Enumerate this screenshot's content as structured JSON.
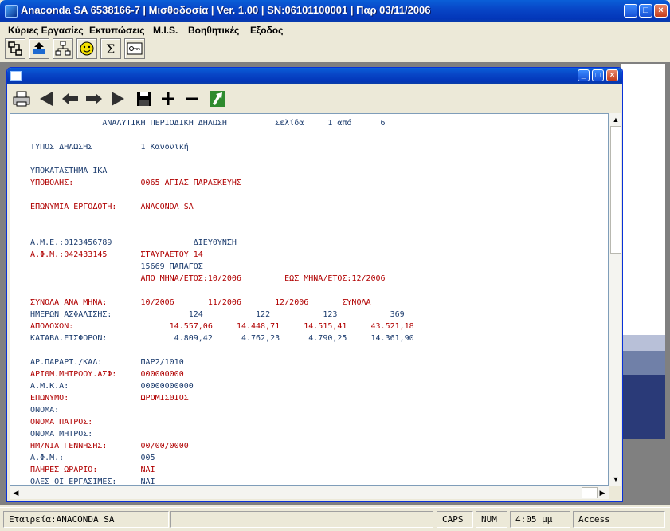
{
  "window": {
    "title": "Anaconda SA 6538166-7 | Μισθοδοσία | Ver. 1.00 | SN:06101100001 | Παρ 03/11/2006",
    "minimize": "_",
    "maximize": "□",
    "close": "×"
  },
  "menu": [
    "Κύριες Εργασίες",
    "Εκτυπώσεις",
    "M.I.S.",
    "Βοηθητικές",
    "Εξοδος"
  ],
  "main_toolbar_icons": [
    "org-chart-icon",
    "import-icon",
    "network-icon",
    "smiley-icon",
    "sigma-icon",
    "key-icon"
  ],
  "child_toolbar_icons": [
    "print-icon",
    "first-page-icon",
    "prev-page-icon",
    "next-page-icon",
    "last-page-icon",
    "save-icon",
    "zoom-in-icon",
    "zoom-out-icon",
    "exit-icon"
  ],
  "report": {
    "lines": [
      {
        "text": "                  ΑΝΑΛΥΤΙΚΗ ΠΕΡΙΟΔΙΚΗ ΔΗΛΩΣΗ          Σελίδα     1 από      6",
        "color": "blue"
      },
      {
        "text": "",
        "color": "blue"
      },
      {
        "text": "   ΤΥΠΟΣ ΔΗΛΩΣΗΣ          1 Κανονική",
        "color": "blue"
      },
      {
        "text": "",
        "color": "blue"
      },
      {
        "text": "   ΥΠΟΚΑΤΑΣΤΗΜΑ ΙΚΑ",
        "color": "blue"
      },
      {
        "text": "   ΥΠΟΒΟΛΗΣ:              0065 ΑΓΙΑΣ ΠΑΡΑΣΚΕΥΗΣ",
        "color": "red"
      },
      {
        "text": "",
        "color": "blue"
      },
      {
        "text": "   ΕΠΩΝΥΜΙΑ ΕΡΓΟΔΟΤΗ:     ANACONDA SA",
        "color": "red"
      },
      {
        "text": "",
        "color": "blue"
      },
      {
        "text": "",
        "color": "blue"
      },
      {
        "text": "   Α.Μ.Ε.:0123456789                 ΔΙΕΥΘΥΝΣΗ",
        "color": "blue"
      },
      {
        "text": "   Α.Φ.Μ.:042433145       ΣΤΑΥΡΑΕΤΟΥ 14",
        "color": "red"
      },
      {
        "text": "                          15669 ΠΑΠΑΓΟΣ",
        "color": "blue"
      },
      {
        "text": "                          ΑΠΟ ΜΗΝΑ/ΕΤΟΣ:10/2006         ΕΩΣ ΜΗΝΑ/ΕΤΟΣ:12/2006",
        "color": "red"
      },
      {
        "text": "",
        "color": "blue"
      },
      {
        "text": "   ΣΥΝΟΛΑ ΑΝΑ ΜΗΝΑ:       10/2006       11/2006       12/2006       ΣΥΝΟΛΑ",
        "color": "red"
      },
      {
        "text": "   ΗΜΕΡΩΝ ΑΣΦΑΛΙΣΗΣ:                124           122           123           369",
        "color": "blue"
      },
      {
        "text": "   ΑΠΟΔΟΧΩΝ:                    14.557,06     14.448,71     14.515,41     43.521,18",
        "color": "red"
      },
      {
        "text": "   ΚΑΤΑΒΛ.ΕΙΣΦΟΡΩΝ:              4.809,42      4.762,23      4.790,25     14.361,90",
        "color": "blue"
      },
      {
        "text": "",
        "color": "blue"
      },
      {
        "text": "   ΑΡ.ΠΑΡΑΡΤ./ΚΑΔ:        ΠΑΡ2/1010",
        "color": "blue"
      },
      {
        "text": "   ΑΡΙΘΜ.ΜΗΤΡΩΟΥ.ΑΣΦ:     000000000",
        "color": "red"
      },
      {
        "text": "   Α.Μ.Κ.Α:               00000000000",
        "color": "blue"
      },
      {
        "text": "   ΕΠΩΝΥΜΟ:               ΩΡΟΜΙΣΘΙΟΣ",
        "color": "red"
      },
      {
        "text": "   ΟΝΟΜΑ:",
        "color": "blue"
      },
      {
        "text": "   ΟΝΟΜΑ ΠΑΤΡΟΣ:",
        "color": "red"
      },
      {
        "text": "   ΟΝΟΜΑ ΜΗΤΡΟΣ:",
        "color": "blue"
      },
      {
        "text": "   ΗΜ/ΝΙΑ ΓΕΝΝΗΣΗΣ:       00/00/0000",
        "color": "red"
      },
      {
        "text": "   Α.Φ.Μ.:                005",
        "color": "blue"
      },
      {
        "text": "   ΠΛΗΡΕΣ ΩΡΑΡΙΟ:         ΝΑΙ",
        "color": "red"
      },
      {
        "text": "   ΟΛΕΣ ΟΙ ΕΡΓΑΣΙΜΕΣ:     ΝΑΙ",
        "color": "blue"
      }
    ]
  },
  "status": {
    "company": "Εταιρεία:ANACONDA SA",
    "caps": "CAPS",
    "num": "NUM",
    "time": "4:05 μμ",
    "app": "Access"
  },
  "colors": {
    "titlebar": "#0846c7",
    "report_blue": "#1c3c6e",
    "report_red": "#b00000"
  }
}
